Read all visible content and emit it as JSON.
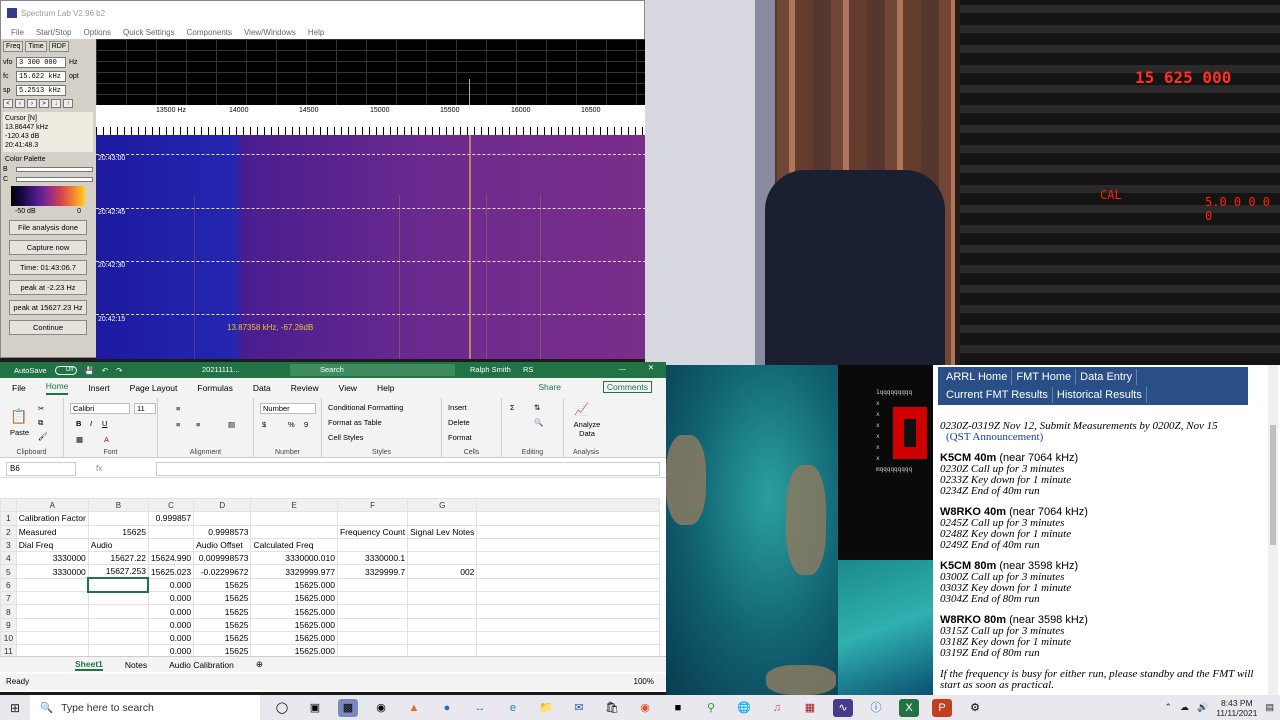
{
  "spectrum_lab": {
    "title": "Spectrum Lab V2.96 b2",
    "menu": [
      "File",
      "Start/Stop",
      "Options",
      "Quick Settings",
      "Components",
      "View/Windows",
      "Help"
    ],
    "tabs": [
      "Freq",
      "Time",
      "RDF"
    ],
    "vfo_label": "vfo",
    "vfo_value": "3 300 000",
    "vfo_unit": "Hz",
    "fc_label": "fc",
    "fc_value": "15.622 kHz",
    "fc_opt": "opt",
    "sp_label": "sp",
    "sp_value": "5.2513 kHz",
    "cursor_lines": [
      "Cursor [N]",
      "13.86447 kHz",
      "-120.43 dB",
      "20:41:48.3"
    ],
    "palette_label": "Color Palette",
    "palette_b": "B",
    "palette_c": "C",
    "scale_min": "-50 dB",
    "scale_max": "0",
    "buttons": [
      "File analysis done",
      "Capture now",
      "Time:  01:43:06.7",
      "peak at -2.23 Hz",
      "peak at 15627.23 Hz",
      "Continue"
    ],
    "freq_ticks": [
      "13500 Hz",
      "14000",
      "14500",
      "15000",
      "15500",
      "16000",
      "16500"
    ],
    "time_labels": [
      "20:43:00",
      "20:42:45",
      "20:42:30",
      "20:42:15"
    ],
    "marker_text": "13.87358 kHz, -67.26dB"
  },
  "video": {
    "led_top": "15 625 000",
    "led_mid": "CAL",
    "led_right": "5.0 0 0 0 0"
  },
  "excel": {
    "autosave": "AutoSave",
    "toggle": "Off",
    "filename": "20211111...",
    "search_placeholder": "Search",
    "user": "Ralph Smith",
    "user_initials": "RS",
    "ribbon_tabs": [
      "File",
      "Home",
      "Insert",
      "Page Layout",
      "Formulas",
      "Data",
      "Review",
      "View",
      "Help"
    ],
    "share": "Share",
    "comments": "Comments",
    "paste": "Paste",
    "clipboard": "Clipboard",
    "font_name": "Calibri",
    "font_size": "11",
    "font_group": "Font",
    "alignment_group": "Alignment",
    "number_format": "Number",
    "number_group": "Number",
    "cond_format": "Conditional Formatting",
    "format_table": "Format as Table",
    "cell_styles": "Cell Styles",
    "styles_group": "Styles",
    "insert": "Insert",
    "delete": "Delete",
    "format": "Format",
    "cells_group": "Cells",
    "editing_group": "Editing",
    "analyze": "Analyze Data",
    "analysis_group": "Analysis",
    "namebox": "B6",
    "fx": "fx",
    "columns": [
      "A",
      "B",
      "C",
      "D",
      "E",
      "F",
      "G"
    ],
    "rows": [
      [
        "1",
        "Calibration Factor",
        "",
        "0.999857",
        "",
        "",
        "",
        ""
      ],
      [
        "2",
        "Measured",
        "15625",
        "",
        "0.9998573",
        "",
        "Frequency Count",
        "Signal Lev Notes"
      ],
      [
        "3",
        "Dial Freq",
        "Audio",
        "",
        "Audio Offset",
        "Calculated Freq",
        "",
        ""
      ],
      [
        "4",
        "3330000",
        "15627.22",
        "15624.990",
        "0.009998573",
        "3330000.010",
        "3330000.1",
        ""
      ],
      [
        "5",
        "3330000",
        "15627.253",
        "15625.023",
        "-0.02299672",
        "3329999.977",
        "3329999.7",
        "002"
      ],
      [
        "6",
        "",
        "",
        "0.000",
        "15625",
        "15625.000",
        "",
        ""
      ],
      [
        "7",
        "",
        "",
        "0.000",
        "15625",
        "15625.000",
        "",
        ""
      ],
      [
        "8",
        "",
        "",
        "0.000",
        "15625",
        "15625.000",
        "",
        ""
      ],
      [
        "9",
        "",
        "",
        "0.000",
        "15625",
        "15625.000",
        "",
        ""
      ],
      [
        "10",
        "",
        "",
        "0.000",
        "15625",
        "15625.000",
        "",
        ""
      ],
      [
        "11",
        "",
        "",
        "0.000",
        "15625",
        "15625.000",
        "",
        ""
      ]
    ],
    "sheets": [
      "Sheet1",
      "Notes",
      "Audio Calibration"
    ],
    "status": "Ready",
    "zoom": "100%"
  },
  "dark_panel": {
    "qq_top": "1qqqqqqqqq",
    "x_marks": [
      "x",
      "x",
      "x",
      "x",
      "x",
      "x",
      "x",
      "x"
    ],
    "qq_bottom": "mqqqqqqqqq"
  },
  "arrl": {
    "nav": [
      "ARRL Home",
      "FMT Home",
      "Data Entry",
      "Current FMT Results",
      "Historical Results"
    ],
    "intro": "0230Z-0319Z Nov 12, Submit Measurements by 0200Z, Nov 15",
    "qst": "(QST Announcement)",
    "sections": [
      {
        "call": "K5CM 40m",
        "near": "(near 7064 kHz)",
        "lines": [
          "0230Z Call up for 3 minutes",
          "0233Z Key down for 1 minute",
          "0234Z End of 40m run"
        ]
      },
      {
        "call": "W8RKO 40m",
        "near": "(near 7064 kHz)",
        "lines": [
          "0245Z Call up for 3 minutes",
          "0248Z Key down for 1 minute",
          "0249Z End of 40m run"
        ]
      },
      {
        "call": "K5CM 80m",
        "near": "(near 3598 kHz)",
        "lines": [
          "0300Z Call up for 3 minutes",
          "0303Z Key down for 1 minute",
          "0304Z End of 80m run"
        ]
      },
      {
        "call": "W8RKO 80m",
        "near": "(near 3598 kHz)",
        "lines": [
          "0315Z Call up for 3 minutes",
          "0318Z Key down for 1 minute",
          "0319Z End of 80m run"
        ]
      }
    ],
    "footer": "If the frequency is busy for either run, please standby and the FMT will start as soon as practical."
  },
  "taskbar": {
    "search_placeholder": "Type here to search",
    "time": "8:43 PM",
    "date": "11/11/2021"
  }
}
